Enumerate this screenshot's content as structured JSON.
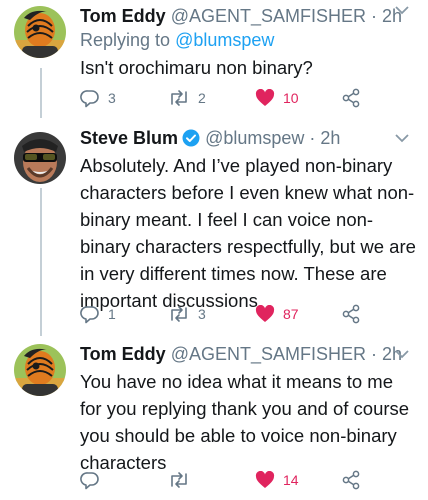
{
  "tweets": [
    {
      "name": "Tom Eddy",
      "handle": "@AGENT_SAMFISHER",
      "time": "2h",
      "replying_label": "Replying to",
      "replying_handle": "@blumspew",
      "text": "Isn't orochimaru non binary?",
      "replies": "3",
      "retweets": "2",
      "likes": "10"
    },
    {
      "name": "Steve Blum",
      "handle": "@blumspew",
      "time": "2h",
      "verified": true,
      "text": "Absolutely. And I’ve played non-binary characters before I even knew what non-binary meant. I feel I can voice non-binary characters respectfully, but we are in very different times now. These are important discussions.",
      "replies": "1",
      "retweets": "3",
      "likes": "87"
    },
    {
      "name": "Tom Eddy",
      "handle": "@AGENT_SAMFISHER",
      "time": "2h",
      "text": "You have no idea what it means to me for you replying thank you and of course you should be able to voice non-binary characters",
      "likes": "14"
    }
  ],
  "colors": {
    "like": "#e0245e",
    "link": "#1da1f2",
    "muted": "#657786",
    "verified": "#1da1f2"
  },
  "icons": [
    "reply-icon",
    "retweet-icon",
    "heart-icon",
    "share-icon",
    "chevron-down-icon",
    "verified-badge-icon"
  ]
}
